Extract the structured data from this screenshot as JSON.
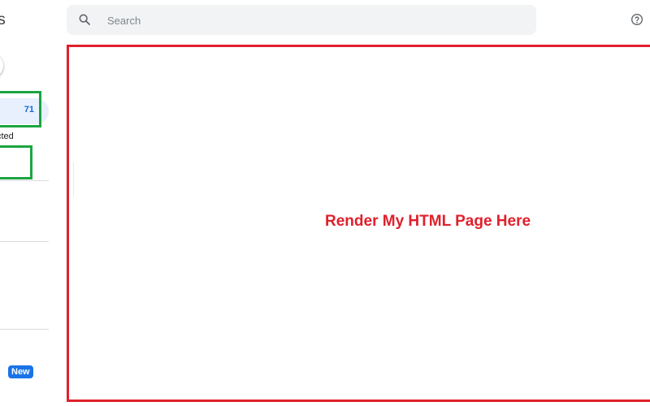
{
  "sidebar": {
    "app_title_fragment": "ts",
    "contacts_count": "71",
    "subtext_fragment": "cted",
    "new_badge": "New"
  },
  "search": {
    "placeholder": "Search",
    "value": ""
  },
  "main": {
    "overlay_text": "Render My HTML Page Here"
  },
  "colors": {
    "accent_blue": "#1a73e8",
    "highlight_green": "#1aa541",
    "frame_red": "#e0202c",
    "search_bg": "#f1f3f4"
  },
  "icons": {
    "search": "search-icon",
    "help": "help-icon"
  }
}
